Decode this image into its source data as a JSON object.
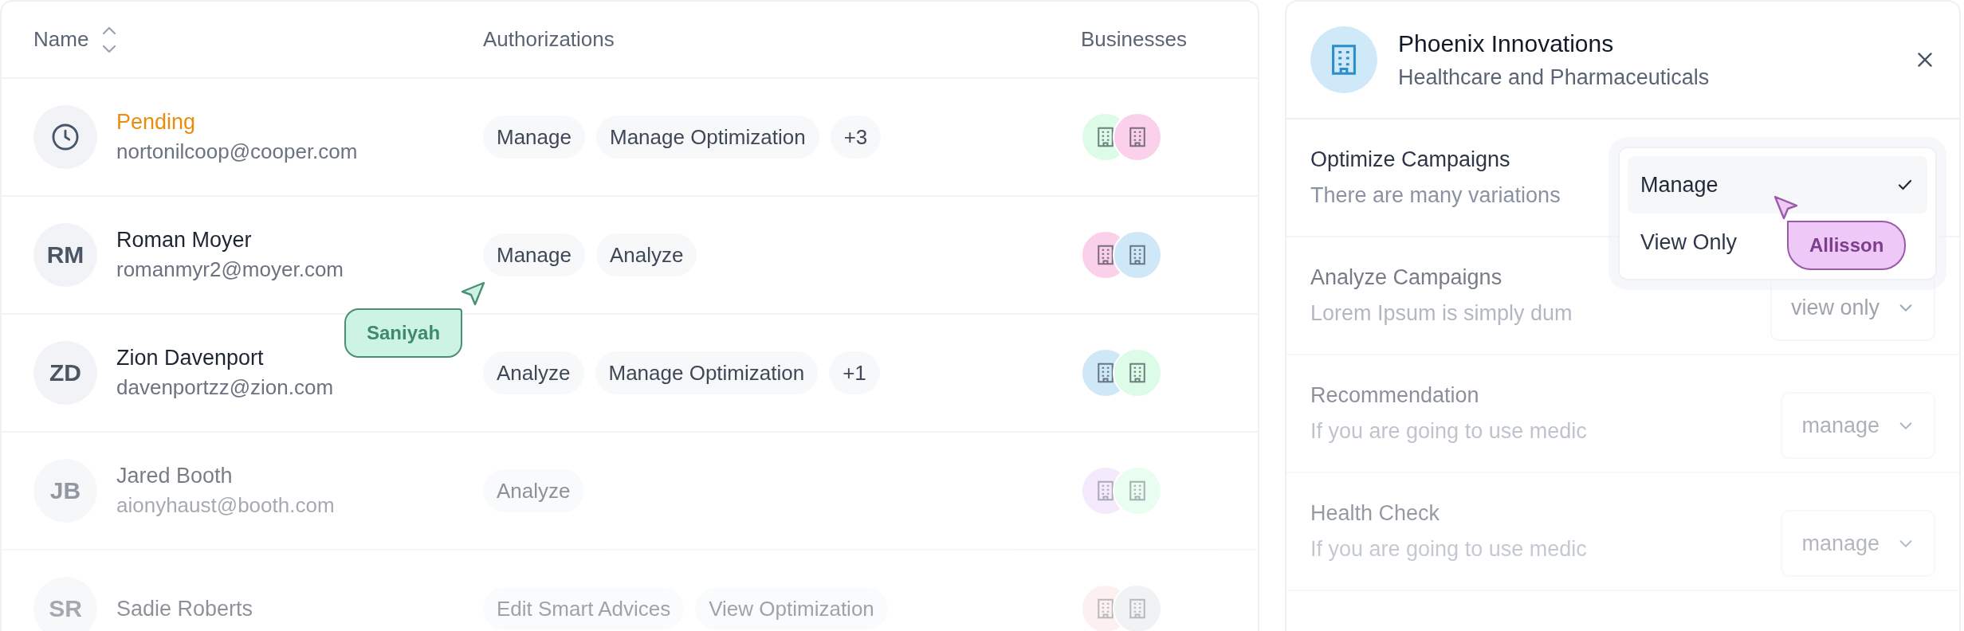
{
  "table": {
    "columns": [
      {
        "label": "Name",
        "sortable": true
      },
      {
        "label": "Authorizations"
      },
      {
        "label": "Businesses"
      }
    ],
    "rows": [
      {
        "kind": "pending",
        "name": "Pending",
        "email": "nortonilcoop@cooper.com",
        "authorizations": [
          "Manage",
          "Manage Optimization",
          "+3"
        ],
        "businesses": [
          {
            "color": "#dcfce7"
          },
          {
            "color": "#fbd0ea"
          }
        ]
      },
      {
        "kind": "user",
        "initials": "RM",
        "name": "Roman Moyer",
        "email": "romanmyr2@moyer.com",
        "authorizations": [
          "Manage",
          "Analyze"
        ],
        "businesses": [
          {
            "color": "#fbd0ea"
          },
          {
            "color": "#cfe8f8"
          }
        ]
      },
      {
        "kind": "user",
        "initials": "ZD",
        "name": "Zion Davenport",
        "email": "davenportzz@zion.com",
        "authorizations": [
          "Analyze",
          "Manage Optimization",
          "+1"
        ],
        "businesses": [
          {
            "color": "#cfe8f8"
          },
          {
            "color": "#dcfce7"
          }
        ]
      },
      {
        "kind": "user",
        "initials": "JB",
        "name": "Jared Booth",
        "email": "aionyhaust@booth.com",
        "authorizations": [
          "Analyze"
        ],
        "businesses": [
          {
            "color": "#f0dcfb"
          },
          {
            "color": "#dcfce7"
          }
        ]
      },
      {
        "kind": "user",
        "initials": "SR",
        "name": "Sadie Roberts",
        "authorizations": [
          "Edit Smart Advices",
          "View Optimization"
        ],
        "businesses": [
          {
            "color": "#fde2e2"
          },
          {
            "color": "#e5e7eb"
          }
        ]
      }
    ]
  },
  "cursors": [
    {
      "name": "Saniyah",
      "color": "#cdf3e3"
    },
    {
      "name": "Allisson",
      "color": "#eec8f7"
    }
  ],
  "panel": {
    "title": "Phoenix Innovations",
    "subtitle": "Healthcare and Pharmaceuticals",
    "permissions": [
      {
        "title": "Optimize Campaigns",
        "description": "There are many variations"
      },
      {
        "title": "Analyze Campaigns",
        "description": "Lorem Ipsum is simply dum",
        "value": "view only"
      },
      {
        "title": "Recommendation",
        "description": "If you are going to use medic",
        "value": "manage"
      },
      {
        "title": "Health Check",
        "description": "If you are going to use medic",
        "value": "manage"
      }
    ],
    "dropdown": {
      "options": [
        {
          "label": "Manage",
          "selected": true
        },
        {
          "label": "View Only",
          "selected": false
        }
      ]
    }
  }
}
